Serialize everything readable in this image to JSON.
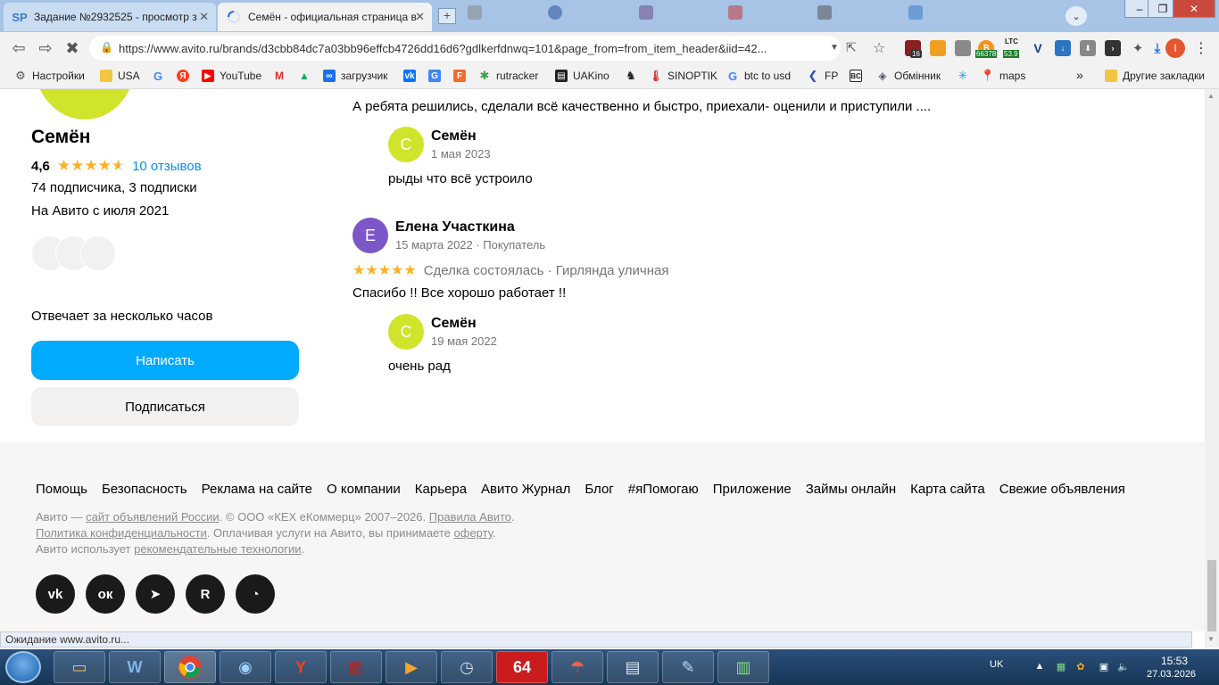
{
  "tabs": [
    {
      "favicon": "SP",
      "title": "Задание №2932525 - просмотр з",
      "active": false
    },
    {
      "favicon": "loading-spinner",
      "title": "Семён - официальная страница в",
      "active": true
    }
  ],
  "window_controls": {
    "minimize": "–",
    "maximize": "❐",
    "close": "✕"
  },
  "toolbar": {
    "url": "https://www.avito.ru/brands/d3cbb84dc7a03bb96effcb4726dd16d6?gdlkerfdnwq=101&page_from=from_item_header&iid=42...",
    "ext_badge_count": "16",
    "ltc_label": "LTC",
    "ltc_value": "53.9",
    "btc_value": "66378",
    "profile_initial": "I"
  },
  "bookmarks": [
    {
      "label": "Настройки",
      "icon": "gear-icon"
    },
    {
      "label": "USA",
      "icon": "folder-icon"
    },
    {
      "label": "",
      "icon": "google-icon"
    },
    {
      "label": "",
      "icon": "yandex-icon"
    },
    {
      "label": "YouTube",
      "icon": "youtube-icon"
    },
    {
      "label": "",
      "icon": "gmail-icon"
    },
    {
      "label": "",
      "icon": "drive-icon"
    },
    {
      "label": "загрузчик",
      "icon": "loop-icon"
    },
    {
      "label": "",
      "icon": "vk-icon"
    },
    {
      "label": "",
      "icon": "translate-icon"
    },
    {
      "label": "",
      "icon": "f-icon"
    },
    {
      "label": "rutracker",
      "icon": "rutracker-icon"
    },
    {
      "label": "UAKino",
      "icon": "uakino-icon"
    },
    {
      "label": "",
      "icon": "chess-icon"
    },
    {
      "label": "SINOPTIK",
      "icon": "thermometer-icon"
    },
    {
      "label": "btc to usd",
      "icon": "google-icon"
    },
    {
      "label": "FP",
      "icon": "fp-icon"
    },
    {
      "label": "",
      "icon": "bc-icon"
    },
    {
      "label": "Обмінник",
      "icon": "exchange-icon"
    },
    {
      "label": "",
      "icon": "star-bm-icon"
    },
    {
      "label": "maps",
      "icon": "maps-icon"
    },
    {
      "label": "Другие закладки",
      "icon": "folder-icon"
    }
  ],
  "bookmarks_more": "»",
  "profile": {
    "name": "Семён",
    "rating": "4,6",
    "reviews_link": "10 отзывов",
    "followers": "74 подписчика, 3 подписки",
    "since": "На Авито с июля 2021",
    "response_time": "Отвечает за несколько часов",
    "write_button": "Написать",
    "subscribe_button": "Подписаться"
  },
  "reviews": {
    "truncated_text": "А ребята решились, сделали всё качественно и быстро, приехали- оценили и приступили ....",
    "reply1": {
      "initial": "С",
      "name": "Семён",
      "date": "1 мая 2023",
      "text": "рыды что всё устроило"
    },
    "review2": {
      "initial": "Е",
      "name": "Елена Участкина",
      "date": "15 марта 2022 · Покупатель",
      "stars": "★★★★★",
      "meta": "Сделка состоялась · Гирлянда уличная",
      "text": "Спасибо !! Все хорошо работает !!"
    },
    "reply2": {
      "initial": "С",
      "name": "Семён",
      "date": "19 мая 2022",
      "text": "очень рад"
    }
  },
  "footer": {
    "links": [
      "Помощь",
      "Безопасность",
      "Реклама на сайте",
      "О компании",
      "Карьера",
      "Авито Журнал",
      "Блог",
      "#яПомогаю",
      "Приложение",
      "Займы онлайн",
      "Карта сайта",
      "Свежие объявления"
    ],
    "legal1_a": "Авито — ",
    "legal1_link": "сайт объявлений России",
    "legal1_b": ". © ООО «КЕХ еКоммерц» 2007–2026. ",
    "legal1_link2": "Правила Авито",
    "legal1_c": ".",
    "legal2_link": "Политика конфиденциальности",
    "legal2_a": ". Оплачивая услуги на Авито, вы принимаете ",
    "legal2_link2": "оферту",
    "legal2_b": ".",
    "legal3_a": "Авито использует ",
    "legal3_link": "рекомендательные технологии",
    "legal3_b": ".",
    "social": [
      {
        "icon": "vk-icon",
        "glyph": "vk"
      },
      {
        "icon": "odnoklassniki-icon",
        "glyph": "ок"
      },
      {
        "icon": "telegram-icon",
        "glyph": "➤"
      },
      {
        "icon": "rutube-icon",
        "glyph": "R"
      },
      {
        "icon": "max-messenger-icon",
        "glyph": "◔"
      }
    ]
  },
  "status": "Ожидание www.avito.ru...",
  "taskbar": {
    "items": [
      "explorer",
      "wireguard",
      "chrome",
      "ie",
      "yandex",
      "filezilla",
      "media-player",
      "clock-app",
      "64-app",
      "umbrella",
      "calculator",
      "notepad",
      "task-manager"
    ],
    "lang": "UK",
    "time": "15:53",
    "date": "27.03.2026"
  },
  "colors": {
    "accent": "#00aaff",
    "avatar_lime": "#d0e42c",
    "avatar_purple": "#7b57c8",
    "star": "#ffb021"
  }
}
